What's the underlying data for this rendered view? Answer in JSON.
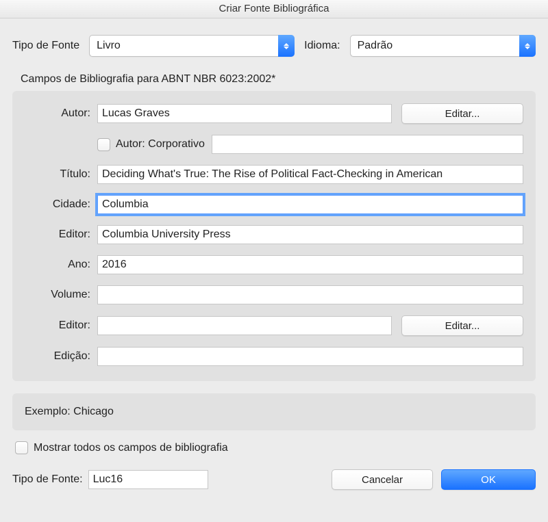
{
  "window": {
    "title": "Criar Fonte Bibliográfica"
  },
  "top": {
    "type_label": "Tipo de Fonte",
    "type_value": "Livro",
    "lang_label": "Idioma:",
    "lang_value": "Padrão"
  },
  "panel_caption": "Campos de Bibliografia para ABNT NBR 6023:2002*",
  "fields": {
    "author_label": "Autor:",
    "author_value": "Lucas Graves",
    "author_edit": "Editar...",
    "corporate_label": "Autor: Corporativo",
    "corporate_value": "",
    "title_label": "Título:",
    "title_value": "Deciding What's True: The Rise of Political Fact-Checking in American",
    "city_label": "Cidade:",
    "city_value": "Columbia",
    "publisher_label": "Editor:",
    "publisher_value": "Columbia University Press",
    "year_label": "Ano:",
    "year_value": "2016",
    "volume_label": "Volume:",
    "volume_value": "",
    "editor_label": "Editor:",
    "editor_value": "",
    "editor_edit": "Editar...",
    "edition_label": "Edição:",
    "edition_value": ""
  },
  "example": {
    "text": "Exemplo: Chicago"
  },
  "show_all": {
    "label": "Mostrar todos os campos de bibliografia"
  },
  "footer": {
    "type_label": "Tipo de Fonte:",
    "type_value": "Luc16",
    "cancel": "Cancelar",
    "ok": "OK"
  }
}
